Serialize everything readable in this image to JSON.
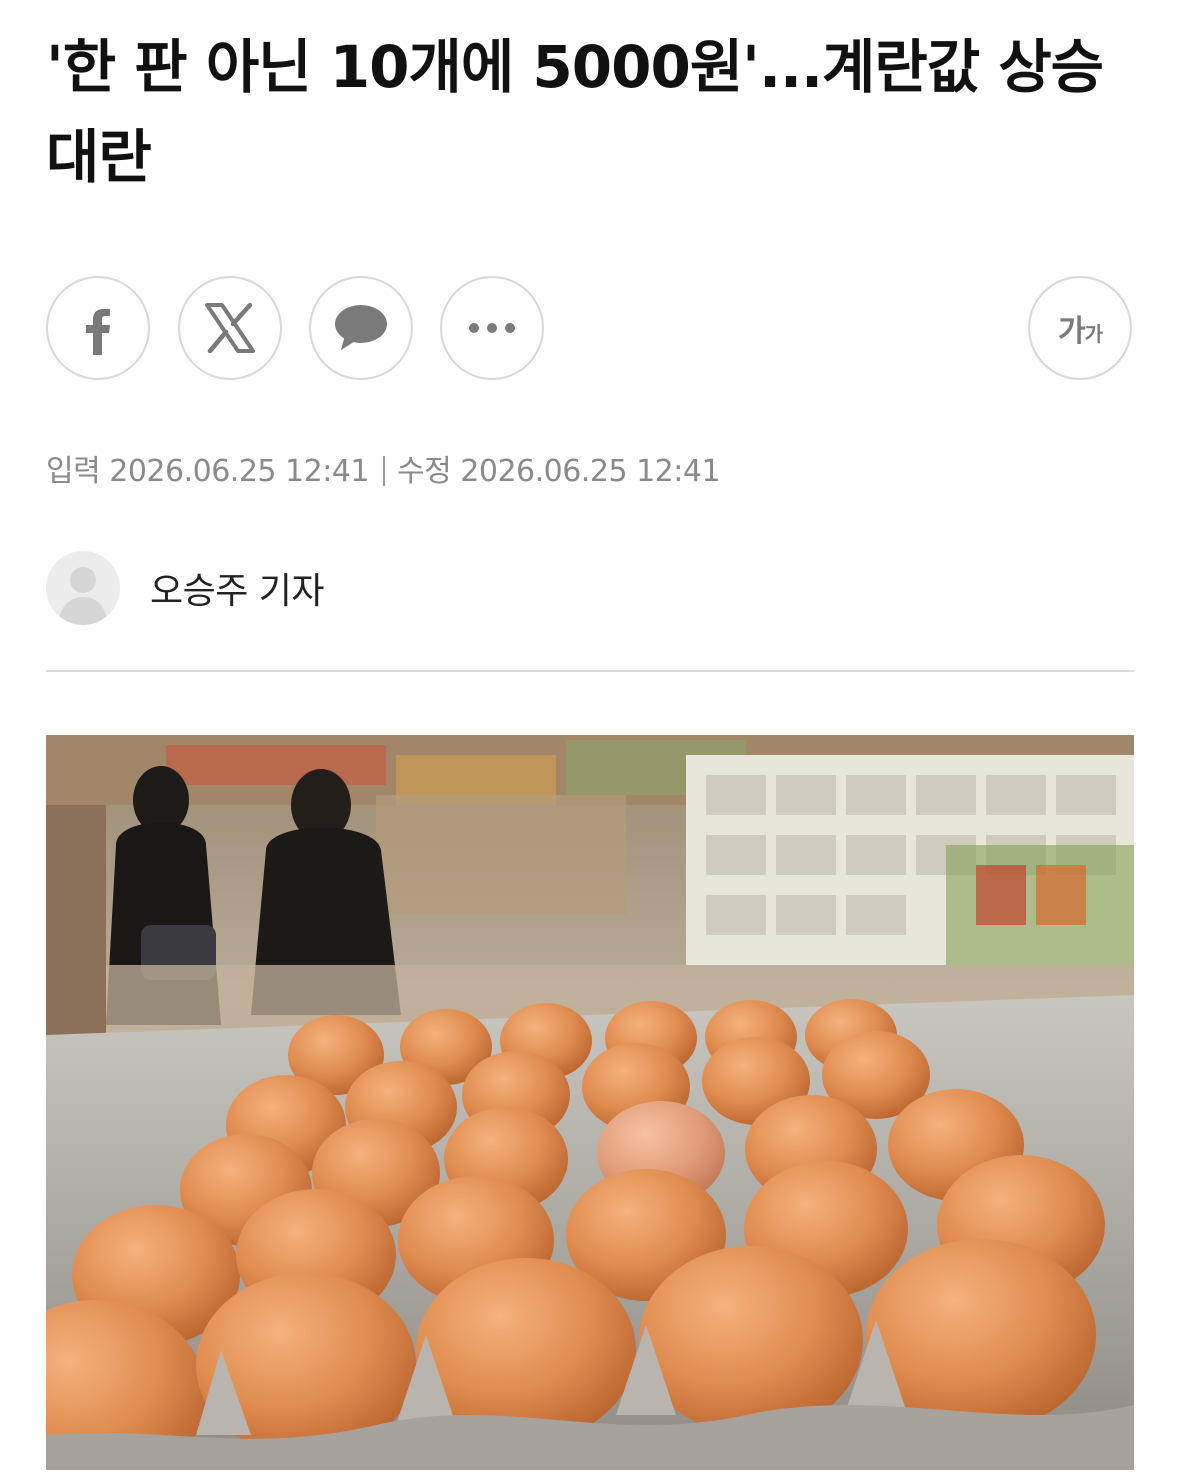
{
  "article": {
    "headline": "'한 판 아닌 10개에 5000원'...계란값 상승 대란",
    "dateline": {
      "published_label": "입력",
      "published": "2026.06.25 12:41",
      "modified_label": "수정",
      "modified": "2026.06.25 12:41"
    },
    "author": "오승주 기자"
  },
  "share": {
    "buttons": [
      {
        "icon": "facebook-icon"
      },
      {
        "icon": "x-icon"
      },
      {
        "icon": "kakaotalk-speech-bubble-icon"
      },
      {
        "icon": "more-icon"
      }
    ],
    "font_size_label_large": "가",
    "font_size_label_small": "가"
  },
  "colors": {
    "text": "#111111",
    "meta": "#8a8a8a",
    "icon": "#7a7a7a",
    "button_border": "#d7d7d7",
    "divider": "#dcdcdc"
  }
}
